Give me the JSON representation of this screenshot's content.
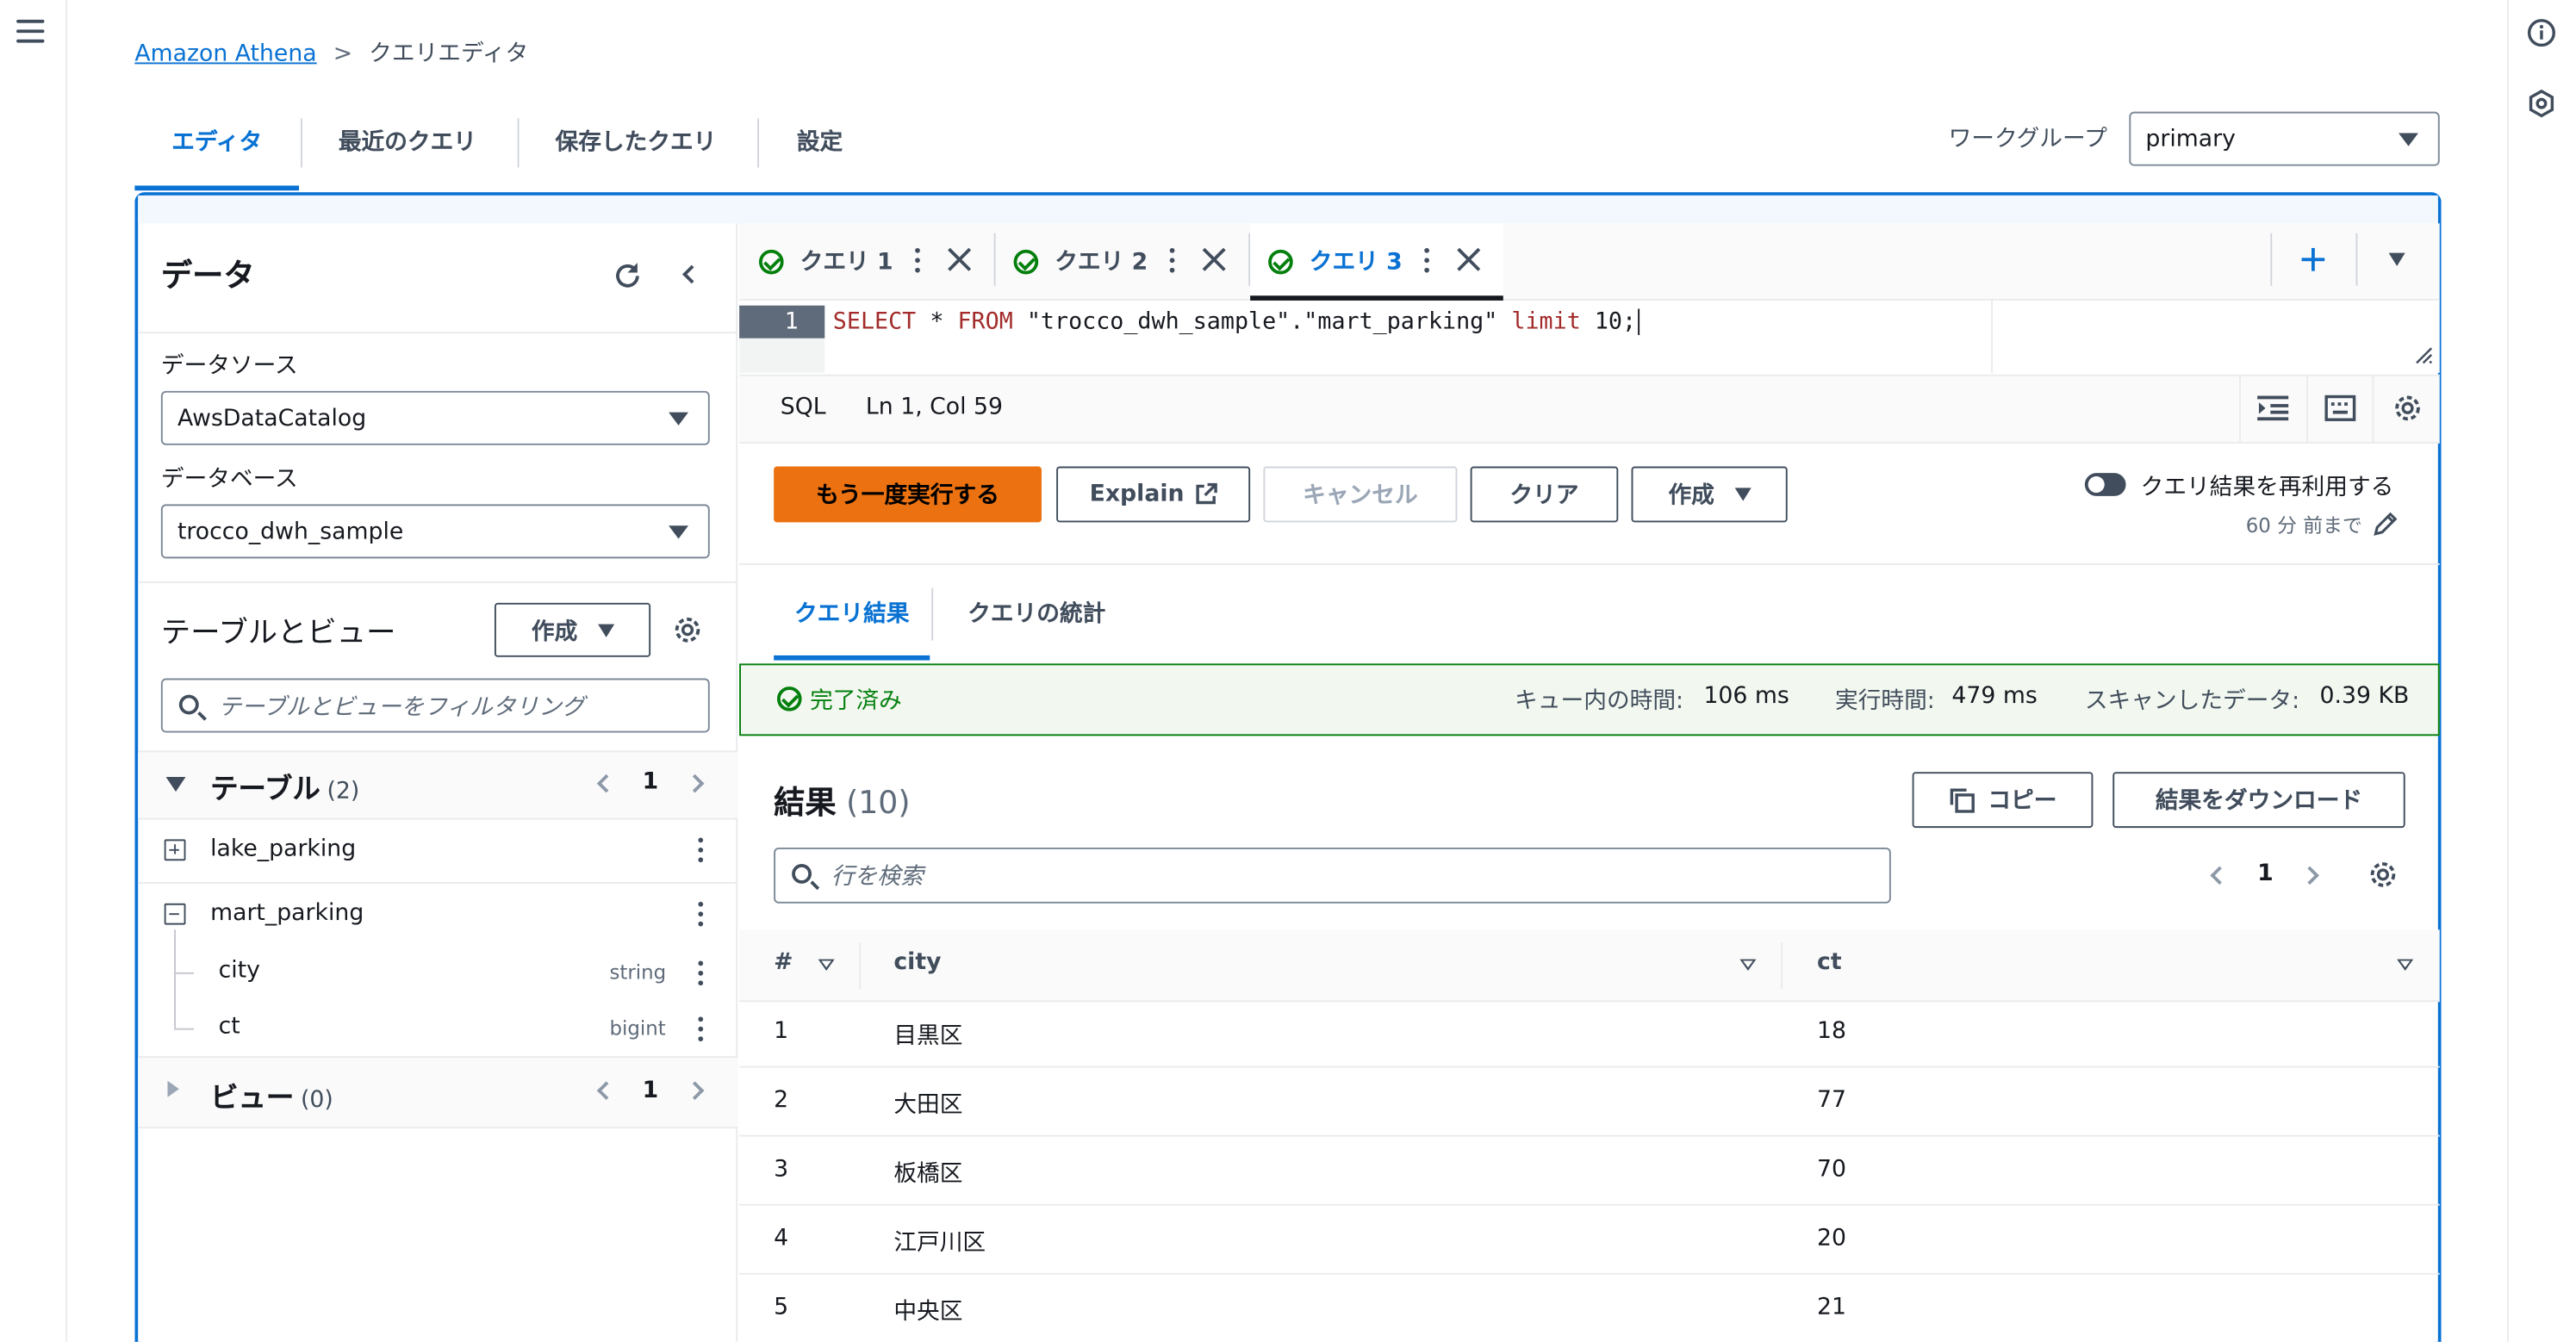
{
  "breadcrumb": {
    "root": "Amazon Athena",
    "current": "クエリエディタ"
  },
  "main_tabs": [
    {
      "label": "エディタ",
      "active": true
    },
    {
      "label": "最近のクエリ",
      "active": false
    },
    {
      "label": "保存したクエリ",
      "active": false
    },
    {
      "label": "設定",
      "active": false
    }
  ],
  "workgroup": {
    "label": "ワークグループ",
    "value": "primary"
  },
  "data_panel": {
    "title": "データ",
    "datasource_label": "データソース",
    "datasource_value": "AwsDataCatalog",
    "database_label": "データベース",
    "database_value": "trocco_dwh_sample",
    "tables_views_title": "テーブルとビュー",
    "create_label": "作成",
    "filter_placeholder": "テーブルとビューをフィルタリング",
    "tables_label": "テーブル",
    "tables_count": "(2)",
    "tables_page": "1",
    "tables": [
      {
        "name": "lake_parking",
        "expanded": false
      },
      {
        "name": "mart_parking",
        "expanded": true,
        "columns": [
          {
            "name": "city",
            "type": "string"
          },
          {
            "name": "ct",
            "type": "bigint"
          }
        ]
      }
    ],
    "views_label": "ビュー",
    "views_count": "(0)",
    "views_page": "1"
  },
  "query_tabs": [
    {
      "label": "クエリ 1",
      "active": false
    },
    {
      "label": "クエリ 2",
      "active": false
    },
    {
      "label": "クエリ 3",
      "active": true
    }
  ],
  "editor": {
    "line_number": "1",
    "sql": {
      "select": "SELECT",
      "star": " * ",
      "from": "FROM",
      "table": " \"trocco_dwh_sample\".\"mart_parking\" ",
      "limit": "limit",
      "num": " 10",
      "end": ";"
    },
    "language": "SQL",
    "cursor": "Ln 1, Col 59"
  },
  "actions": {
    "run_again": "もう一度実行する",
    "explain": "Explain",
    "cancel": "キャンセル",
    "clear": "クリア",
    "create": "作成",
    "reuse_results": "クエリ結果を再利用する",
    "reuse_age": "60 分 前まで"
  },
  "result_tabs": [
    {
      "label": "クエリ結果",
      "active": true
    },
    {
      "label": "クエリの統計",
      "active": false
    }
  ],
  "status": {
    "state": "完了済み",
    "queue_label": "キュー内の時間:",
    "queue_value": "106 ms",
    "run_label": "実行時間:",
    "run_value": "479 ms",
    "scan_label": "スキャンしたデータ:",
    "scan_value": "0.39 KB"
  },
  "results": {
    "title": "結果",
    "count": "(10)",
    "copy": "コピー",
    "download": "結果をダウンロード",
    "search_placeholder": "行を検索",
    "page": "1",
    "columns": [
      "#",
      "city",
      "ct"
    ],
    "rows": [
      [
        "1",
        "目黒区",
        "18"
      ],
      [
        "2",
        "大田区",
        "77"
      ],
      [
        "3",
        "板橋区",
        "70"
      ],
      [
        "4",
        "江戸川区",
        "20"
      ],
      [
        "5",
        "中央区",
        "21"
      ]
    ]
  },
  "colors": {
    "primary": "#0972d3",
    "accent": "#ec7211",
    "success": "#037f0c",
    "text": "#16191f"
  }
}
